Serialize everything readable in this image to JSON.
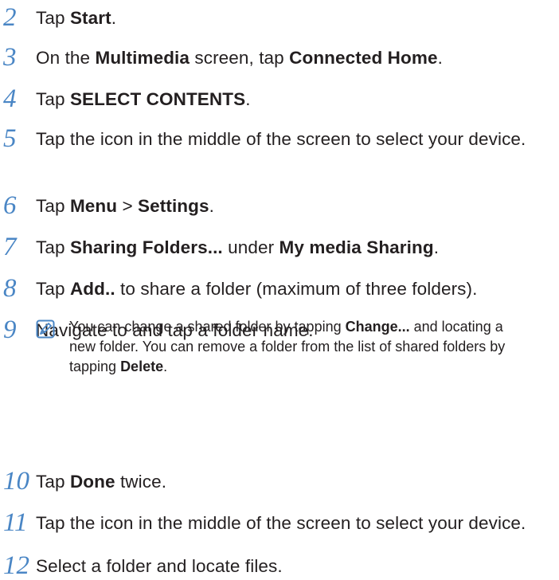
{
  "steps": [
    {
      "num": "2",
      "parts": [
        [
          "Tap ",
          false
        ],
        [
          "Start",
          true
        ],
        [
          ".",
          false
        ]
      ]
    },
    {
      "num": "3",
      "parts": [
        [
          "On the ",
          false
        ],
        [
          "Multimedia",
          true
        ],
        [
          " screen, tap ",
          false
        ],
        [
          "Connected Home",
          true
        ],
        [
          ".",
          false
        ]
      ]
    },
    {
      "num": "4",
      "parts": [
        [
          "Tap ",
          false
        ],
        [
          "SELECT CONTENTS",
          true
        ],
        [
          ".",
          false
        ]
      ]
    },
    {
      "num": "5",
      "parts": [
        [
          "Tap the icon in the middle of the screen to select your device.",
          false
        ]
      ]
    },
    {
      "num": "6",
      "parts": [
        [
          "Tap ",
          false
        ],
        [
          "Menu",
          true
        ],
        [
          " > ",
          false
        ],
        [
          "Settings",
          true
        ],
        [
          ".",
          false
        ]
      ]
    },
    {
      "num": "7",
      "parts": [
        [
          "Tap ",
          false
        ],
        [
          "Sharing Folders...",
          true
        ],
        [
          " under ",
          false
        ],
        [
          "My media Sharing",
          true
        ],
        [
          ".",
          false
        ]
      ]
    },
    {
      "num": "8",
      "parts": [
        [
          "Tap ",
          false
        ],
        [
          "Add..",
          true
        ],
        [
          " to share a folder (maximum of three folders).",
          false
        ]
      ]
    },
    {
      "num": "9",
      "parts": [
        [
          "Navigate to and tap a folder name.",
          false
        ]
      ]
    },
    {
      "num": "10",
      "parts": [
        [
          "Tap ",
          false
        ],
        [
          "Done",
          true
        ],
        [
          " twice.",
          false
        ]
      ]
    },
    {
      "num": "11",
      "parts": [
        [
          "Tap the icon in the middle of the screen to select your device.",
          false
        ]
      ]
    },
    {
      "num": "12",
      "parts": [
        [
          "Select a folder and locate files.",
          false
        ]
      ]
    }
  ],
  "note": {
    "icon": "note-pencil-icon",
    "accent_color": "#4a86c5",
    "parts": [
      [
        "You can change a shared folder by tapping ",
        false
      ],
      [
        "Change...",
        true
      ],
      [
        " and locating a new folder. You can remove a folder from the list of shared folders by tapping ",
        false
      ],
      [
        "Delete",
        true
      ],
      [
        ".",
        false
      ]
    ]
  }
}
